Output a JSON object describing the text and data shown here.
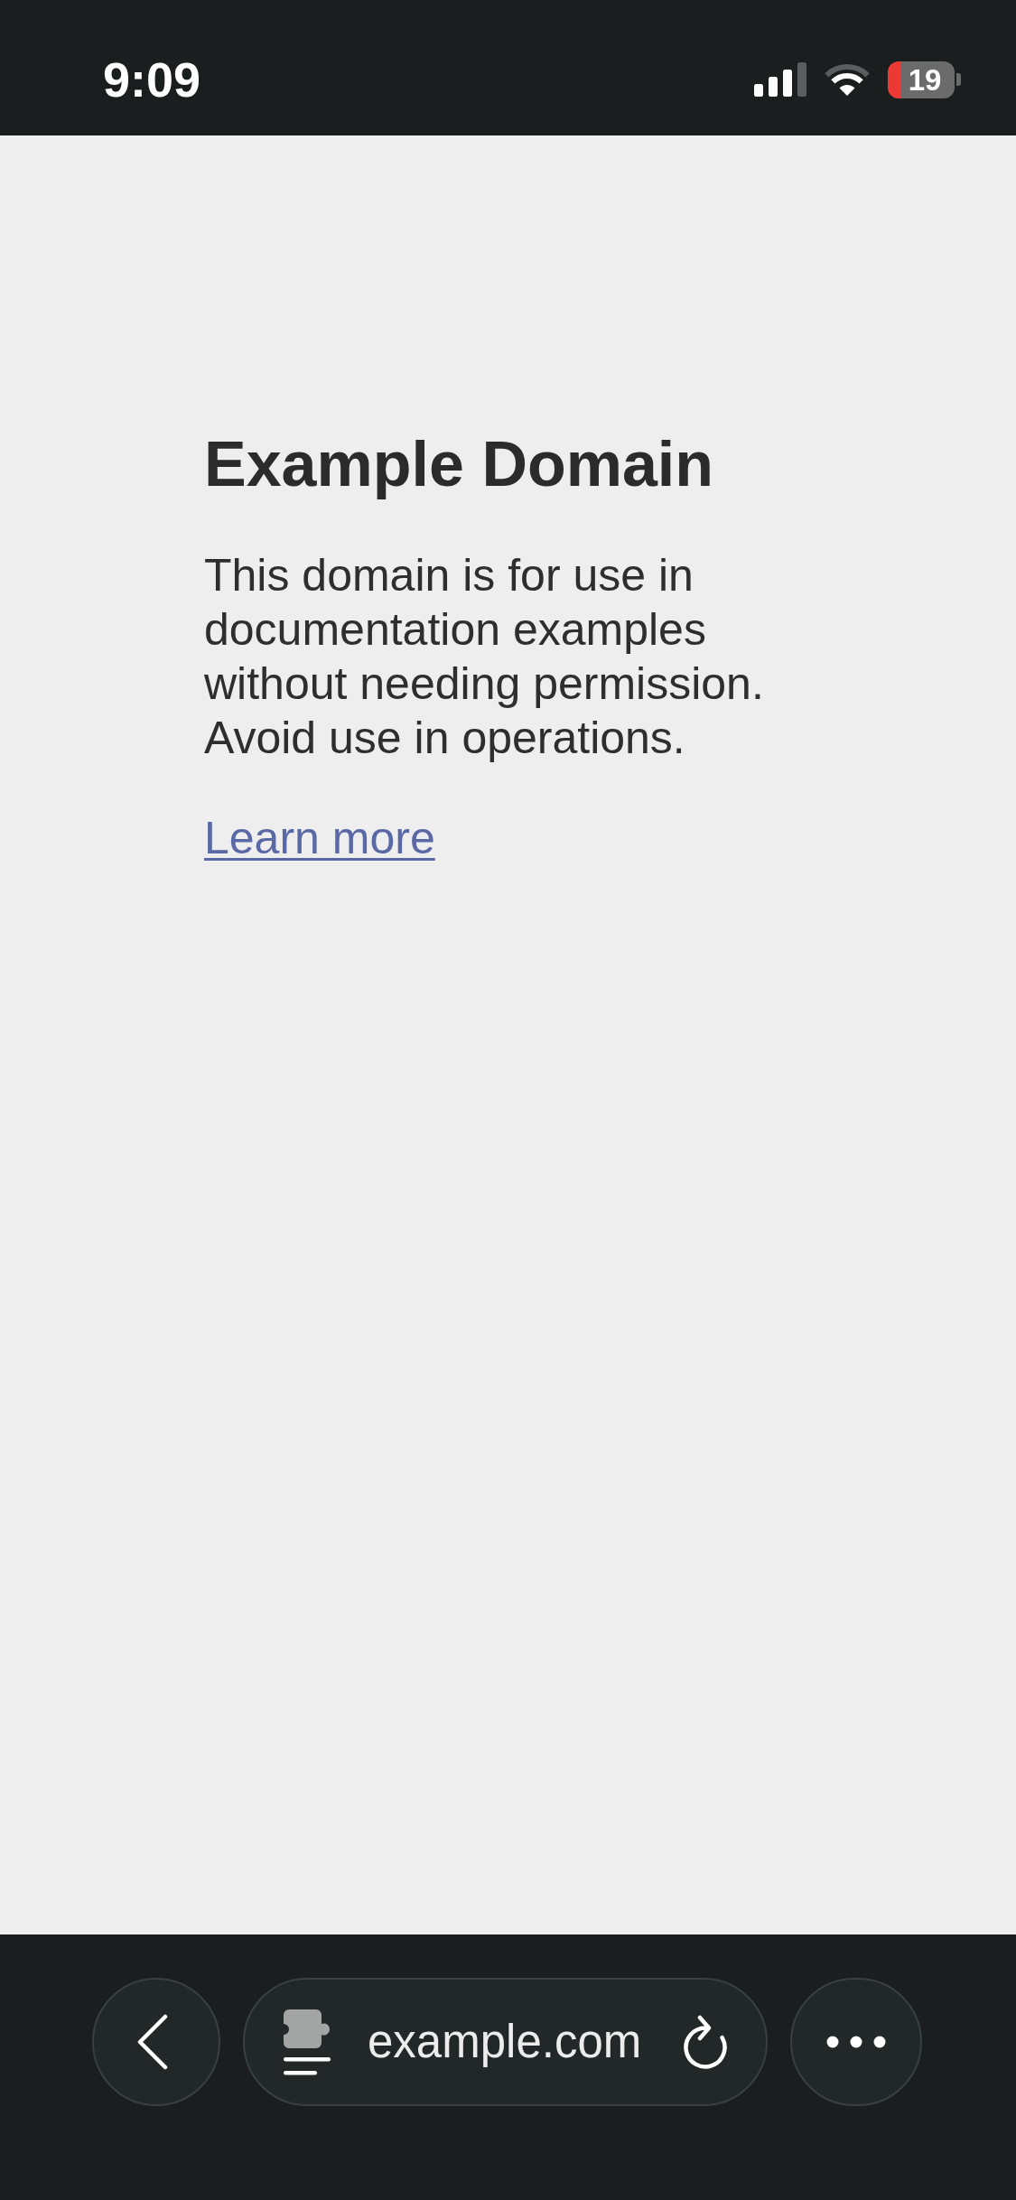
{
  "status_bar": {
    "time": "9:09",
    "battery": {
      "percent": "19",
      "low": true
    }
  },
  "page": {
    "title": "Example Domain",
    "paragraph": "This domain is for use in documentation examples without needing permission. Avoid use in operations.",
    "link": "Learn more"
  },
  "toolbar": {
    "url": "example.com"
  }
}
